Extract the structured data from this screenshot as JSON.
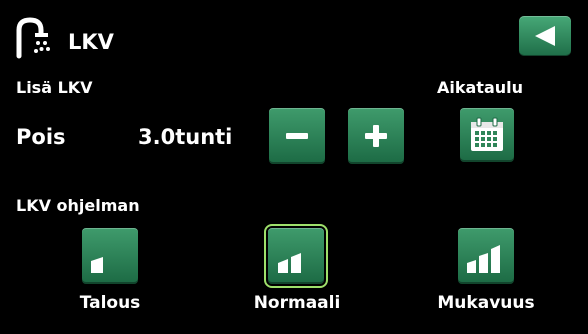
{
  "header": {
    "title": "LKV",
    "icon": "faucet-icon",
    "back_icon": "back-arrow-icon"
  },
  "extra_hot_water": {
    "label": "Lisä LKV",
    "state": "Pois",
    "duration": "3.0tunti",
    "decrease_icon": "minus-icon",
    "increase_icon": "plus-icon"
  },
  "schedule": {
    "label": "Aikataulu",
    "icon": "calendar-icon"
  },
  "program": {
    "label": "LKV ohjelman",
    "modes": [
      {
        "label": "Talous",
        "icon": "level-1-bars-icon",
        "selected": false
      },
      {
        "label": "Normaali",
        "icon": "level-2-bars-icon",
        "selected": true
      },
      {
        "label": "Mukavuus",
        "icon": "level-3-bars-icon",
        "selected": false
      }
    ]
  },
  "colors": {
    "background": "#000000",
    "button_green": "#2e8558",
    "selected_outline": "#9ee06b",
    "text": "#ffffff"
  }
}
